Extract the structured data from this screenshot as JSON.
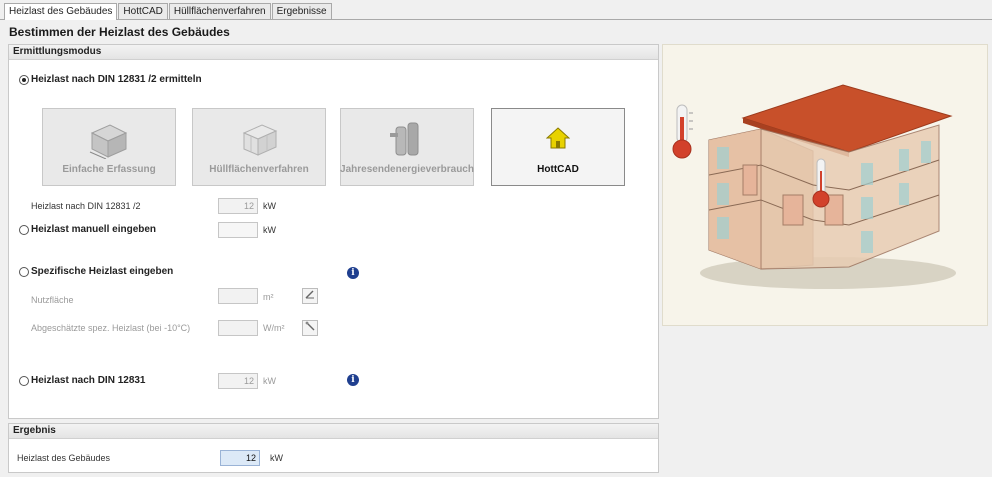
{
  "tabs": [
    "Heizlast des Gebäudes",
    "HottCAD",
    "Hüllflächenverfahren",
    "Ergebnisse"
  ],
  "page_title": "Bestimmen der Heizlast des Gebäudes",
  "ermittlung": {
    "header": "Ermittlungsmodus",
    "option_din_2": "Heizlast nach DIN 12831 /2 ermitteln",
    "buttons": {
      "einfache": "Einfache Erfassung",
      "huell": "Hüllflächenverfahren",
      "jahres": "Jahresendenergieverbrauch",
      "hottcad": "HottCAD"
    },
    "heizlast_din_2_label": "Heizlast nach DIN 12831 /2",
    "heizlast_din_2_value": "12",
    "heizlast_din_2_unit": "kW",
    "option_manuell": "Heizlast manuell eingeben",
    "manuell_value": "",
    "manuell_unit": "kW",
    "option_spezifisch": "Spezifische Heizlast eingeben",
    "nutzflaeche_label": "Nutzfläche",
    "nutzflaeche_value": "",
    "nutzflaeche_unit": "m²",
    "spez_label": "Abgeschätzte spez. Heizlast (bei  -10°C)",
    "spez_value": "",
    "spez_unit": "W/m²",
    "option_din": "Heizlast nach DIN 12831",
    "din_value": "12",
    "din_unit": "kW",
    "info_icon_text": "i"
  },
  "ergebnis": {
    "header": "Ergebnis",
    "label": "Heizlast des Gebäudes",
    "value": "12",
    "unit": "kW"
  },
  "colors": {
    "accent_blue": "#1f3f8f",
    "roof": "#c8502a",
    "thermometer_red": "#d2412b",
    "hottcad_icon": "#e8d200"
  },
  "icons": {
    "info": "info-icon",
    "house": "house-icon",
    "thermometer": "thermometer-icon"
  }
}
